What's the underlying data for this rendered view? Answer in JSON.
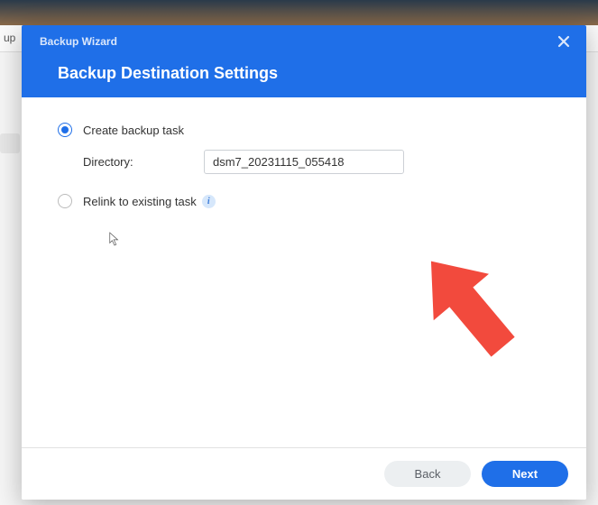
{
  "backdrop": {
    "tab_fragment": "up"
  },
  "modal": {
    "title_small": "Backup Wizard",
    "title_large": "Backup Destination Settings"
  },
  "options": {
    "create": {
      "label": "Create backup task",
      "directory_label": "Directory:",
      "directory_value": "dsm7_20231115_055418"
    },
    "relink": {
      "label": "Relink to existing task",
      "info_tip": "i"
    }
  },
  "footer": {
    "back": "Back",
    "next": "Next"
  },
  "colors": {
    "primary": "#1f6fe8",
    "pointer": "#f24a3d"
  }
}
